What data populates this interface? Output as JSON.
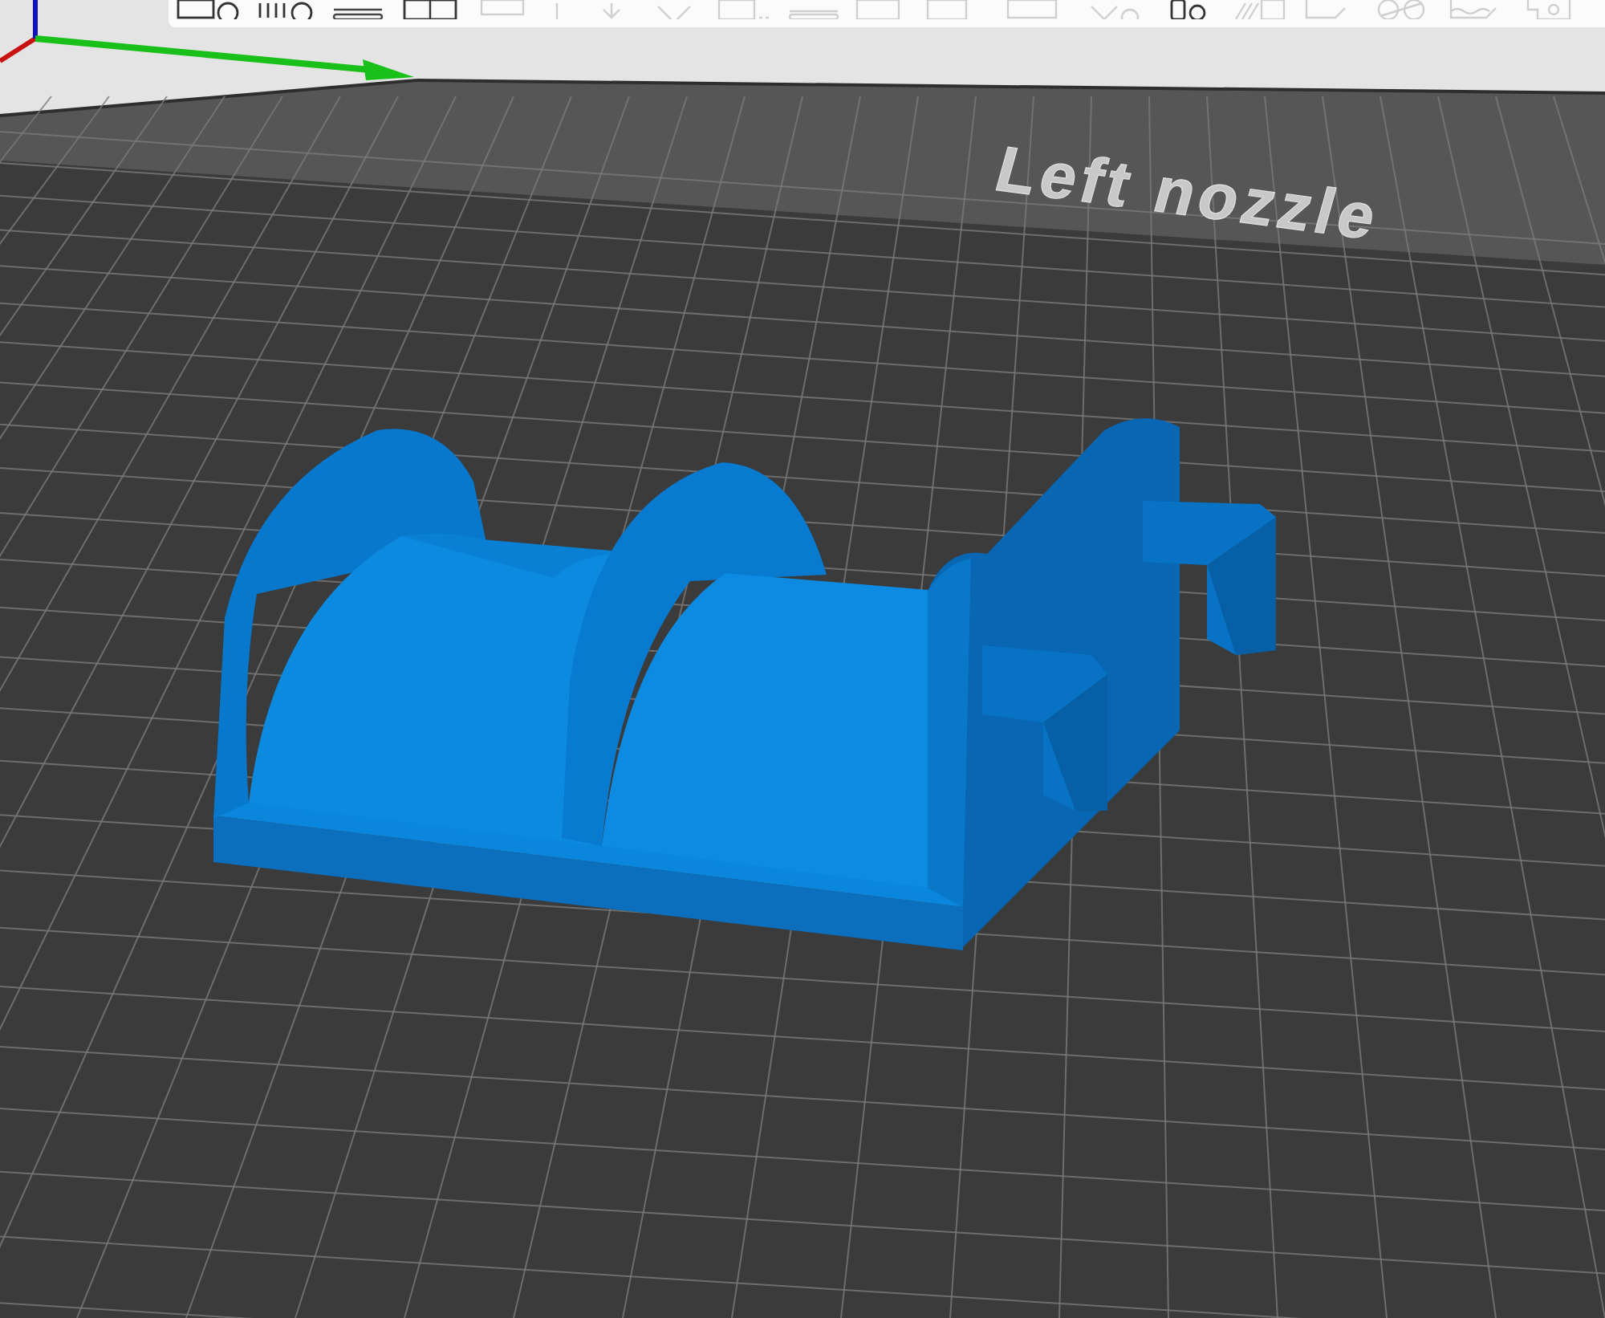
{
  "viewport": {
    "bed_label": "Left nozzle"
  }
}
